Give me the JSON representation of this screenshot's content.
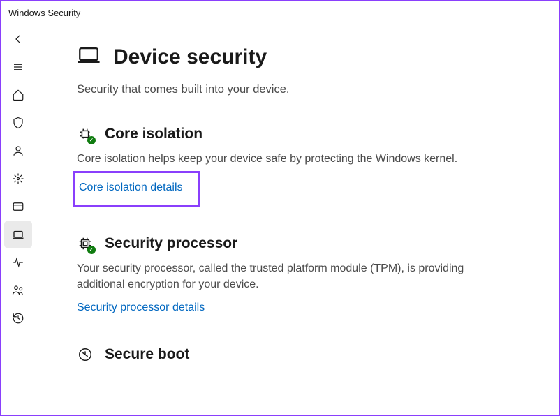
{
  "window": {
    "title": "Windows Security"
  },
  "page": {
    "title": "Device security",
    "subtitle": "Security that comes built into your device."
  },
  "sections": {
    "core_isolation": {
      "title": "Core isolation",
      "description": "Core isolation helps keep your device safe by protecting the Windows kernel.",
      "link": "Core isolation details"
    },
    "security_processor": {
      "title": "Security processor",
      "description": "Your security processor, called the trusted platform module (TPM), is providing additional encryption for your device.",
      "link": "Security processor details"
    },
    "secure_boot": {
      "title": "Secure boot"
    }
  }
}
